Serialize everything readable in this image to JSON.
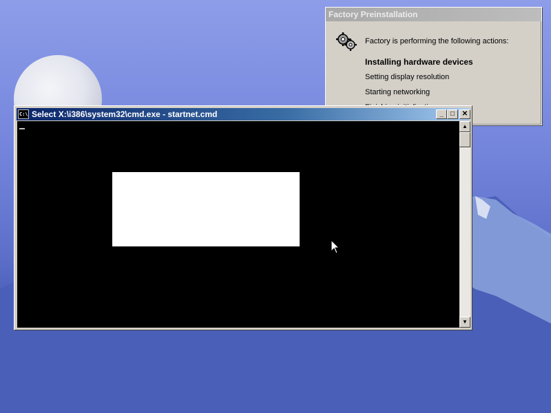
{
  "desktop": {
    "background": "moon and mountain wallpaper"
  },
  "factory_dialog": {
    "title": "Factory Preinstallation",
    "intro": "Factory is performing the following actions:",
    "steps": [
      "Installing hardware devices",
      "Setting display resolution",
      "Starting networking",
      "Finishing initialization"
    ]
  },
  "cmd_window": {
    "title": "Select X:\\i386\\system32\\cmd.exe - startnet.cmd",
    "sys_icon_text": "C:\\",
    "minimize_glyph": "_",
    "maximize_glyph": "□",
    "close_glyph": "✕",
    "scroll_up_glyph": "▲",
    "scroll_down_glyph": "▼"
  },
  "colors": {
    "title_active": "#0a246a",
    "title_inactive": "#a9a9a9",
    "console_bg": "#000000",
    "selection": "#ffffff",
    "dialog_bg": "#d4d0c8"
  }
}
